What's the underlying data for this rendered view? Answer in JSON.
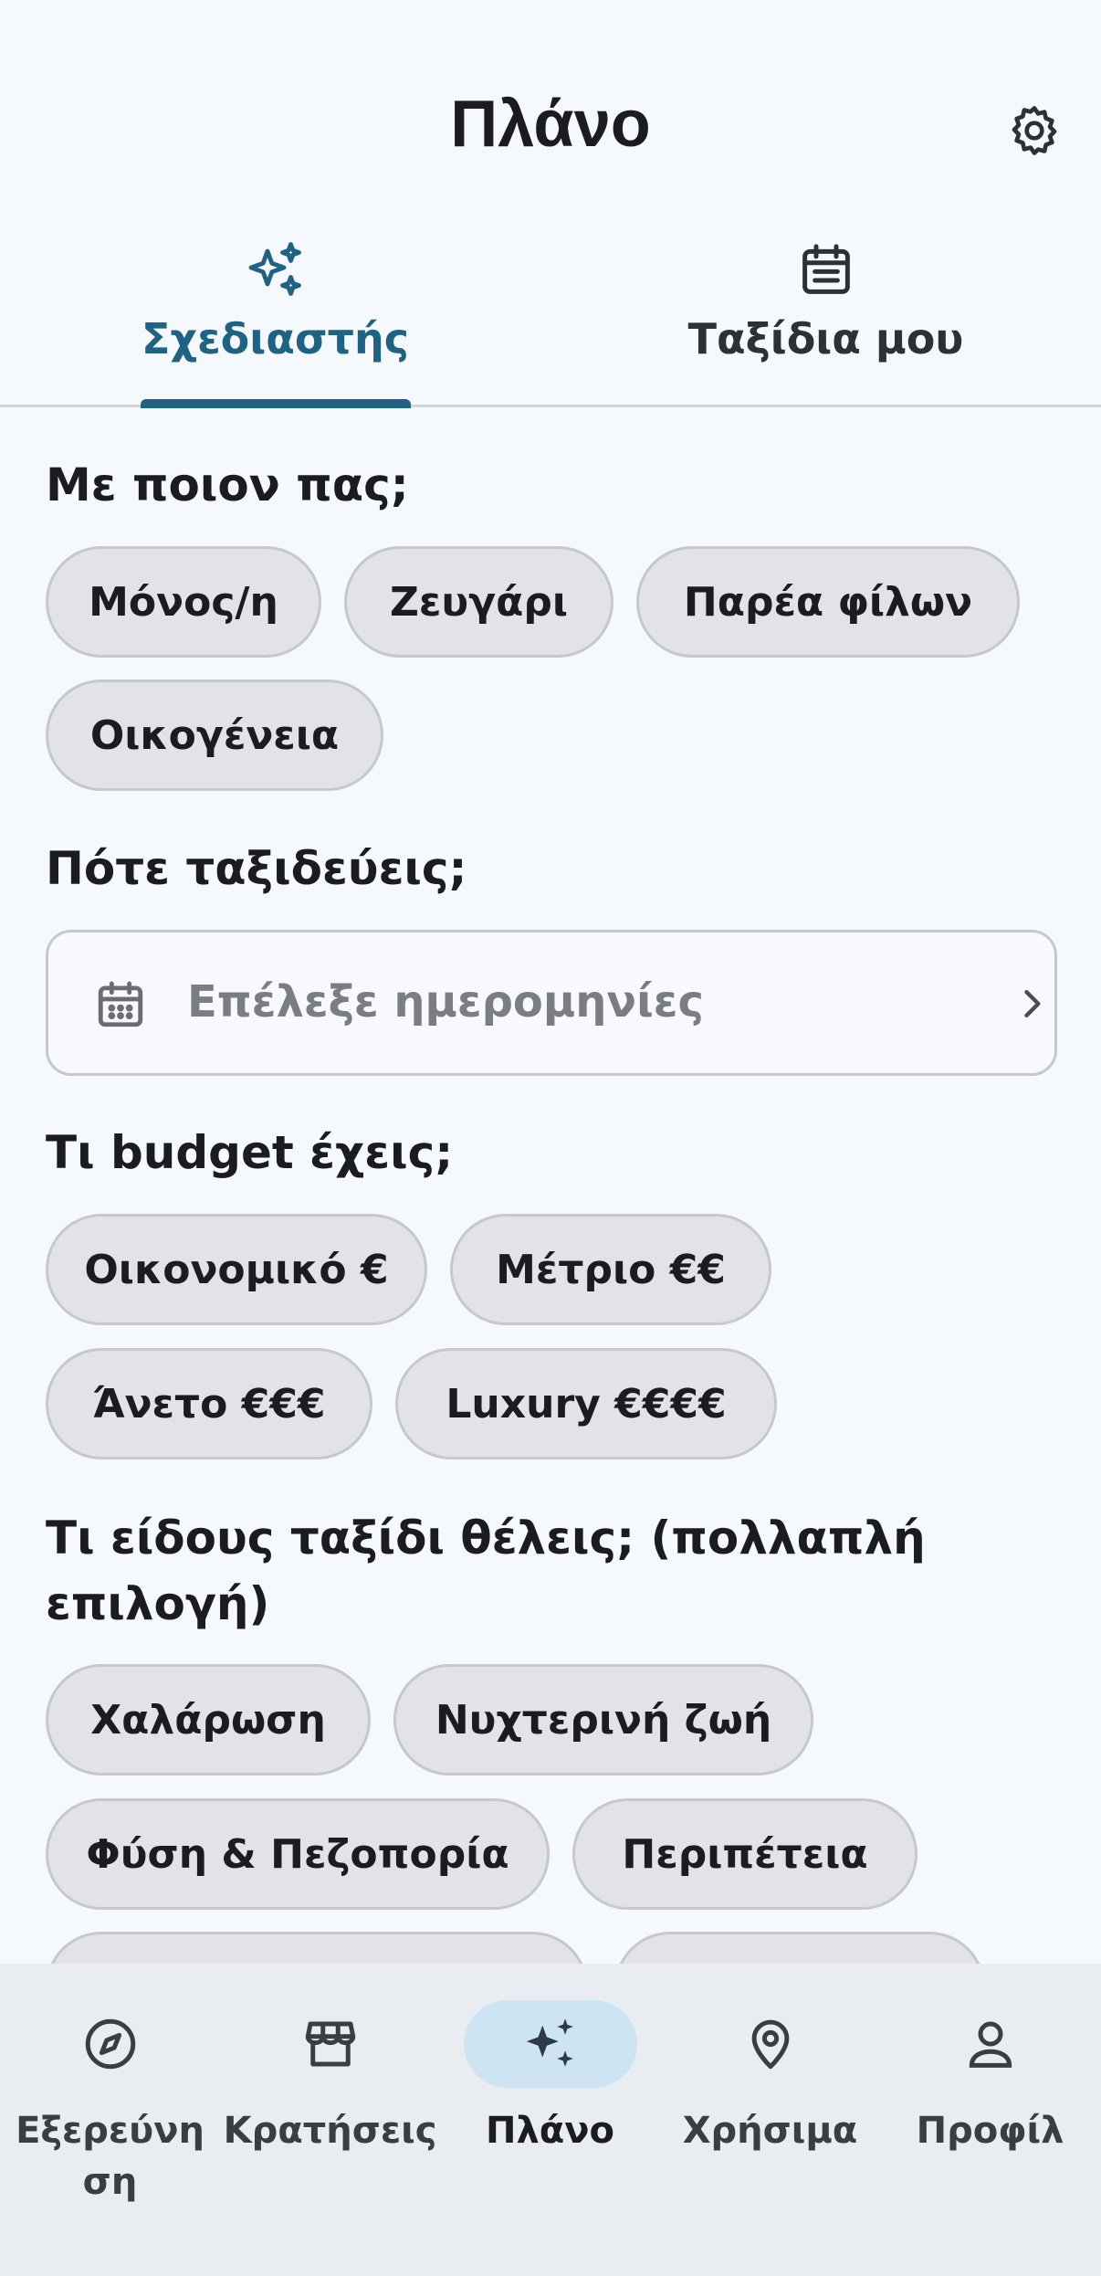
{
  "header": {
    "title": "Πλάνο"
  },
  "tabs": [
    {
      "label": "Σχεδιαστής",
      "icon": "sparkles-icon",
      "active": true
    },
    {
      "label": "Ταξίδια μου",
      "icon": "calendar-list-icon",
      "active": false
    }
  ],
  "companions": {
    "title": "Με ποιον πας;",
    "options": [
      "Μόνος/η",
      "Ζευγάρι",
      "Παρέα φίλων",
      "Οικογένεια"
    ]
  },
  "dates": {
    "title": "Πότε ταξιδεύεις;",
    "placeholder": "Επέλεξε ημερομηνίες"
  },
  "budget": {
    "title": "Τι budget έχεις;",
    "options": [
      "Οικονομικό €",
      "Μέτριο €€",
      "Άνετο €€€",
      "Luxury €€€€"
    ]
  },
  "trip_type": {
    "title": "Τι είδους ταξίδι θέλεις; (πολλαπλή επιλογή)",
    "options": [
      "Χαλάρωση",
      "Νυχτερινή ζωή",
      "Φύση & Πεζοπορία",
      "Περιπέτεια"
    ]
  },
  "bottom_nav": [
    {
      "label": "Εξερεύνηση",
      "icon": "compass-icon"
    },
    {
      "label": "Κρατήσεις",
      "icon": "store-icon"
    },
    {
      "label": "Πλάνο",
      "icon": "sparkles-icon",
      "active": true
    },
    {
      "label": "Χρήσιμα",
      "icon": "location-pin-icon"
    },
    {
      "label": "Προφίλ",
      "icon": "person-icon"
    }
  ],
  "colors": {
    "accent": "#1e6284",
    "chip_bg": "#e1e3e7",
    "nav_active_bg": "#cde4f3",
    "background": "#f5f8fc"
  }
}
